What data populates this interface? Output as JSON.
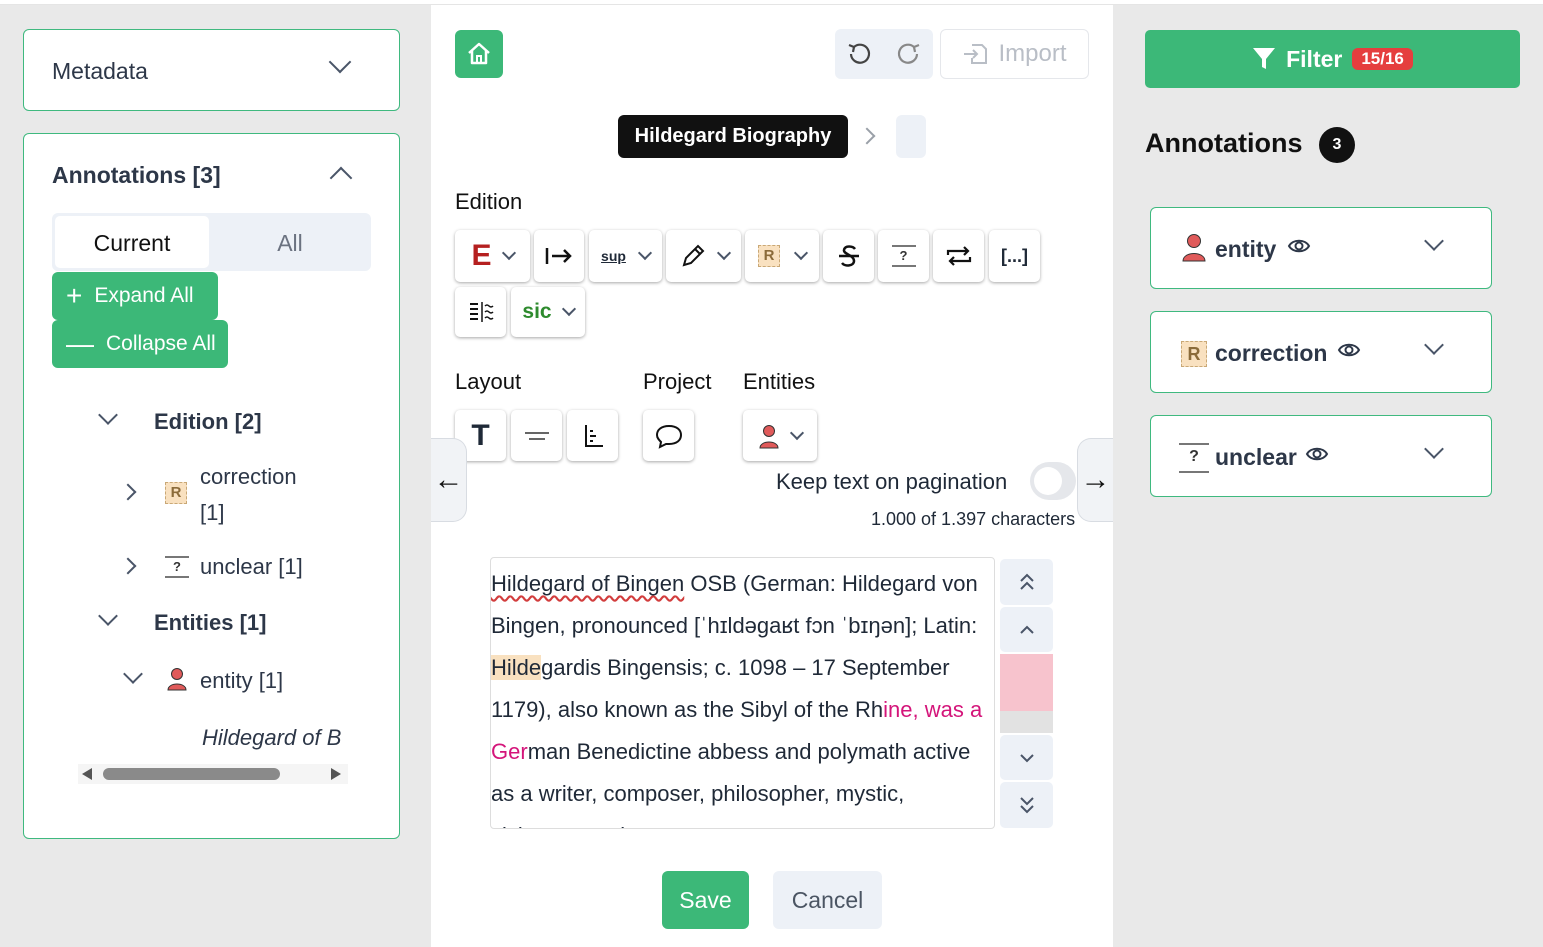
{
  "metadata": {
    "title": "Metadata"
  },
  "left_annotations": {
    "title": "Annotations [3]",
    "tabs": {
      "current": "Current",
      "all": "All"
    },
    "expand_all": "Expand All",
    "collapse_all": "Collapse All",
    "tree": {
      "edition": "Edition [2]",
      "correction_line1": "correction",
      "correction_line2": "[1]",
      "unclear": "unclear [1]",
      "entities": "Entities [1]",
      "entity": "entity [1]",
      "entity_text": "Hildegard of B"
    }
  },
  "toolbar": {
    "import_label": "Import",
    "breadcrumb": "Hildegard Biography",
    "edition_label": "Edition",
    "layout_label": "Layout",
    "project_label": "Project",
    "entities_label": "Entities",
    "tool_e": "E",
    "tool_sup": "sup",
    "tool_r": "R",
    "tool_brackets": "[...]",
    "tool_sic": "sic",
    "tool_t": "T"
  },
  "pagination": {
    "keep_text_label": "Keep text on pagination",
    "char_count": "1.000 of 1.397 characters"
  },
  "editor": {
    "seg1": "Hildegard of Bingen",
    "seg2": " OSB (German: Hildegard von Bingen, pronounced [ˈhɪldəɡaʁt fɔn ˈbɪŋən]; Latin: ",
    "seg3": "Hilde",
    "seg4": "gardis Bingensis; c. 1098 – 17 September 1179), also known as the Sibyl of the Rh",
    "seg5": "ine, was a Ger",
    "seg6": "man Benedictine abbess and polymath active as a writer, composer, philosopher, mystic, visionary, and"
  },
  "actions": {
    "save": "Save",
    "cancel": "Cancel"
  },
  "right": {
    "filter_label": "Filter",
    "filter_badge": "15/16",
    "annotations_title": "Annotations",
    "annotations_count": "3",
    "cards": [
      {
        "label": "entity"
      },
      {
        "label": "correction"
      },
      {
        "label": "unclear"
      }
    ]
  },
  "colors": {
    "accent": "#3cb878",
    "badge_red": "#e53e3e",
    "highlight": "#f9e1c0",
    "pink_text": "#d4157a"
  }
}
